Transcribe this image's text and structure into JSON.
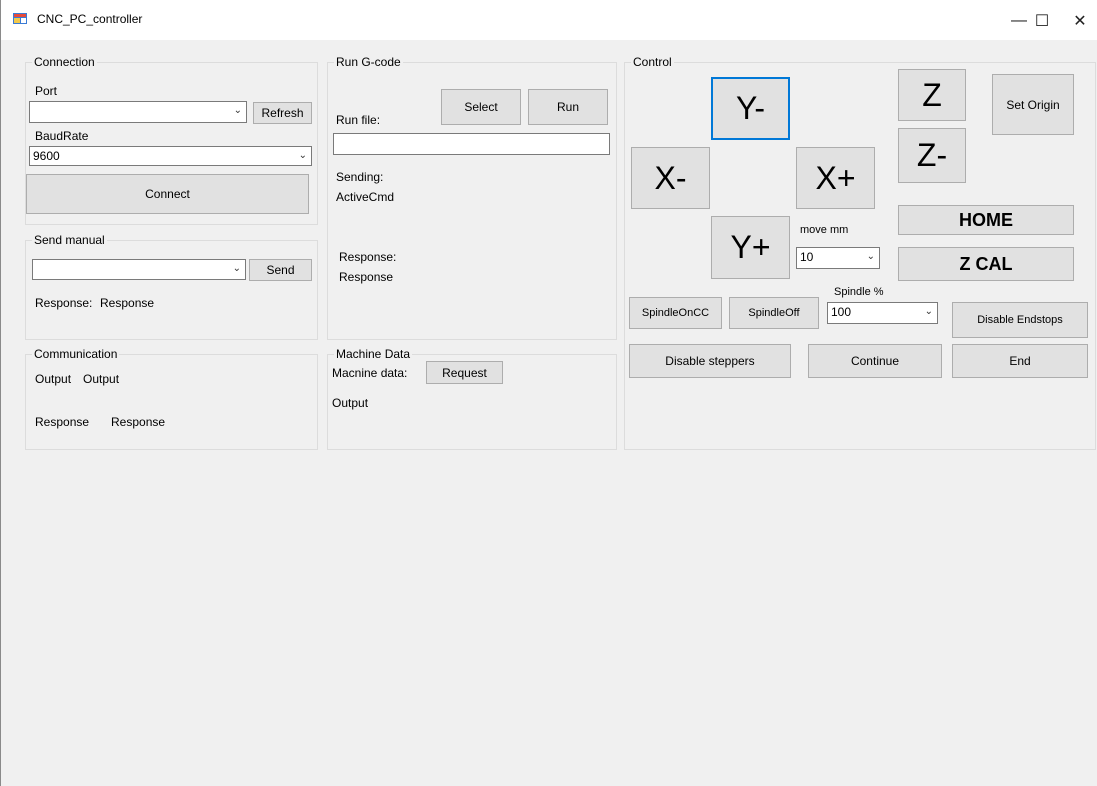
{
  "window": {
    "title": "CNC_PC_controller",
    "controls": {
      "minimize": "—",
      "maximize": "☐",
      "close": "✕"
    }
  },
  "connection": {
    "group_title": "Connection",
    "port_label": "Port",
    "port_value": "",
    "refresh_label": "Refresh",
    "baud_label": "BaudRate",
    "baud_value": "9600",
    "connect_label": "Connect"
  },
  "send_manual": {
    "group_title": "Send manual",
    "command_value": "",
    "send_label": "Send",
    "response_label": "Response:",
    "response_value": "Response"
  },
  "communication": {
    "group_title": "Communication",
    "output_label": "Output",
    "output_value": "Output",
    "response_label": "Response",
    "response_value": "Response"
  },
  "run_gcode": {
    "group_title": "Run G-code",
    "run_file_label": "Run file:",
    "select_label": "Select",
    "run_label": "Run",
    "file_path": "",
    "sending_label": "Sending:",
    "active_cmd": "ActiveCmd",
    "response_label": "Response:",
    "response_value": "Response"
  },
  "machine_data": {
    "group_title": "Machine Data",
    "label": "Macnine data:",
    "request_label": "Request",
    "output_value": "Output"
  },
  "control": {
    "group_title": "Control",
    "y_minus": "Y-",
    "y_plus": "Y+",
    "x_minus": "X-",
    "x_plus": "X+",
    "z_plus": "Z",
    "z_minus": "Z-",
    "set_origin": "Set Origin",
    "home": "HOME",
    "z_cal": "Z CAL",
    "move_mm_label": "move mm",
    "move_mm_value": "10",
    "spindle_label": "Spindle %",
    "spindle_value": "100",
    "spindle_on_cc": "SpindleOnCC",
    "spindle_off": "SpindleOff",
    "disable_endstops": "Disable Endstops",
    "disable_steppers": "Disable steppers",
    "continue": "Continue",
    "end": "End"
  },
  "colors": {
    "focus_border": "#0078d7",
    "button_bg": "#e1e1e1",
    "form_bg": "#f0f0f0"
  }
}
